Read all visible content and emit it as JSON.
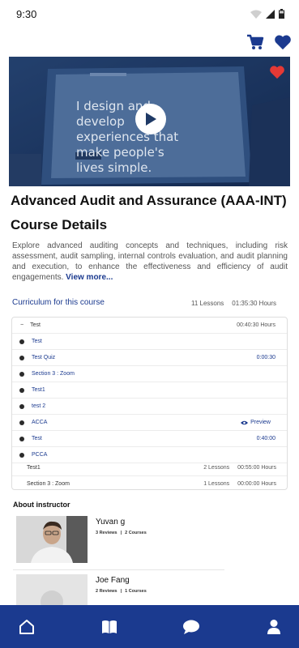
{
  "status": {
    "time": "9:30"
  },
  "header": {
    "cart_icon": "cart-icon",
    "wishlist_icon": "heart-icon"
  },
  "hero": {
    "screen_text": "I design and develop experiences that make people's lives simple.",
    "play_icon": "play-icon",
    "favorite_icon": "heart-icon"
  },
  "course": {
    "title": "Advanced Audit and Assurance (AAA-INT)",
    "details_heading": "Course Details",
    "description": "Explore advanced auditing concepts and techniques, including risk assessment, audit sampling, internal controls evaluation, and audit planning and execution, to enhance the effectiveness and efficiency of audit engagements.",
    "view_more": "View more..."
  },
  "curriculum": {
    "title": "Curriculum for this course",
    "lessons": "11 Lessons",
    "hours": "01:35:30 Hours",
    "open_section": {
      "toggle": "−",
      "title": "Test",
      "duration": "00:40:30 Hours",
      "lessons": [
        {
          "name": "Test",
          "duration": ""
        },
        {
          "name": "Test Quiz",
          "duration": "0:00:30"
        },
        {
          "name": "Section 3 : Zoom",
          "duration": ""
        },
        {
          "name": "Test1",
          "duration": ""
        },
        {
          "name": "test 2",
          "duration": ""
        },
        {
          "name": "ACCA",
          "duration": "",
          "preview": "Preview"
        },
        {
          "name": "Test",
          "duration": "0:40:00"
        },
        {
          "name": "PCCA",
          "duration": ""
        }
      ]
    },
    "sections": [
      {
        "title": "Test1",
        "lessons": "2 Lessons",
        "duration": "00:55:00 Hours"
      },
      {
        "title": "Section 3 : Zoom",
        "lessons": "1 Lessons",
        "duration": "00:00:00 Hours"
      }
    ]
  },
  "instructors": {
    "heading": "About instructor",
    "list": [
      {
        "name": "Yuvan g",
        "reviews": "3 Reviews",
        "courses": "2 Courses"
      },
      {
        "name": "Joe Fang",
        "reviews": "2 Reviews",
        "courses": "1 Courses"
      }
    ]
  },
  "nav": {
    "items": [
      "home-icon",
      "book-icon",
      "chat-icon",
      "profile-icon"
    ]
  },
  "colors": {
    "brand": "#1b3a8f",
    "favorite": "#e53935"
  }
}
